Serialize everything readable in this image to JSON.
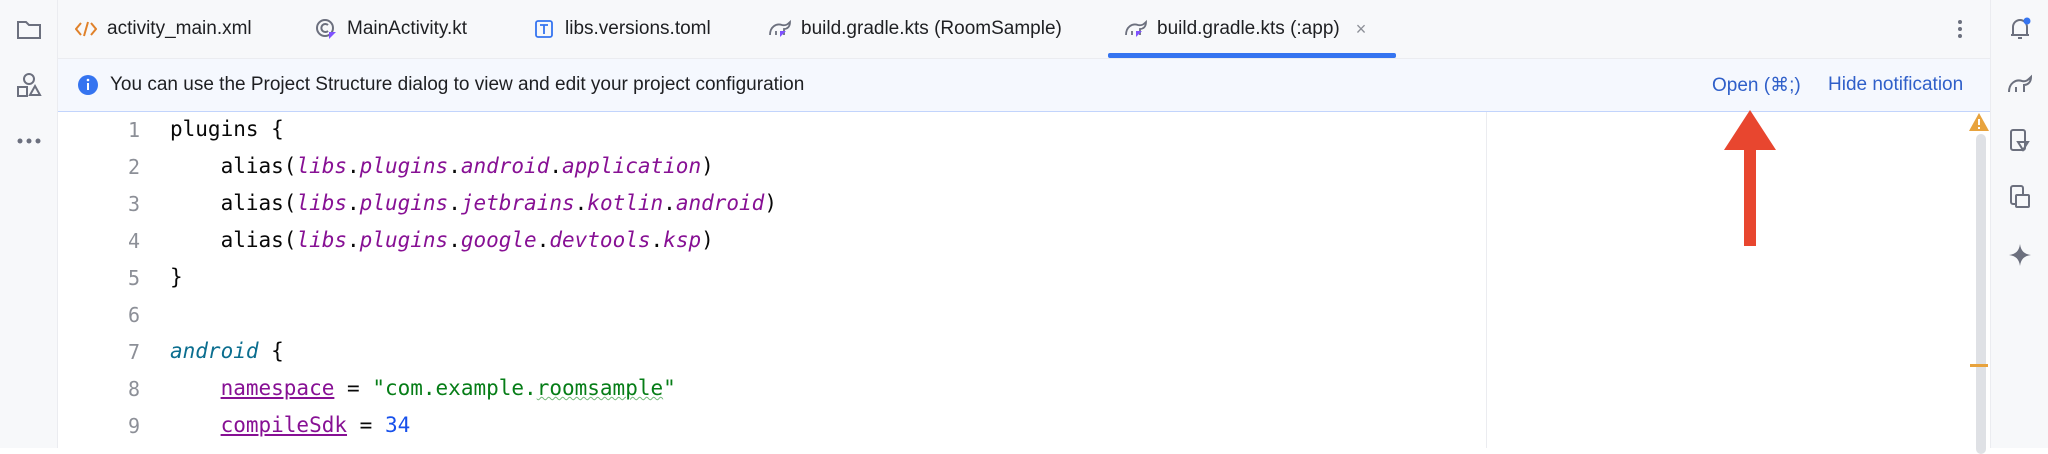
{
  "tabs": [
    {
      "label": "activity_main.xml",
      "icon": "xml-icon"
    },
    {
      "label": "MainActivity.kt",
      "icon": "kotlin-class-icon"
    },
    {
      "label": "libs.versions.toml",
      "icon": "toml-icon"
    },
    {
      "label": "build.gradle.kts (RoomSample)",
      "icon": "gradle-icon"
    },
    {
      "label": "build.gradle.kts (:app)",
      "icon": "gradle-icon",
      "active": true
    }
  ],
  "tab_close": "×",
  "banner": {
    "message": "You can use the Project Structure dialog to view and edit your project configuration",
    "open_label": "Open (⌘;)",
    "hide_label": "Hide notification"
  },
  "editor": {
    "line_numbers": [
      "1",
      "2",
      "3",
      "4",
      "5",
      "6",
      "7",
      "8",
      "9"
    ],
    "lines": {
      "l1_kw": "plugins",
      "l1_brace": " {",
      "alias": "alias(",
      "libs": "libs",
      "plugins": "plugins",
      "l2_a": "android",
      "l2_b": "application",
      "l3_a": "jetbrains",
      "l3_b": "kotlin",
      "l3_c": "android",
      "l4_a": "google",
      "l4_b": "devtools",
      "l4_c": "ksp",
      "close_paren": ")",
      "dot": ".",
      "l5": "}",
      "l7_kw": "android",
      "l7_brace": " {",
      "l8_prop": "namespace",
      "l8_eq": " = ",
      "l8_str_open": "\"com.example.",
      "l8_str_sq": "roomsample",
      "l8_str_close": "\"",
      "l9_prop": "compileSdk",
      "l9_eq": " = ",
      "l9_num": "34"
    }
  },
  "colors": {
    "accent": "#3574f0",
    "link": "#2f5fc9",
    "annotation_arrow": "#e8462f",
    "warning": "#e8a33d"
  }
}
